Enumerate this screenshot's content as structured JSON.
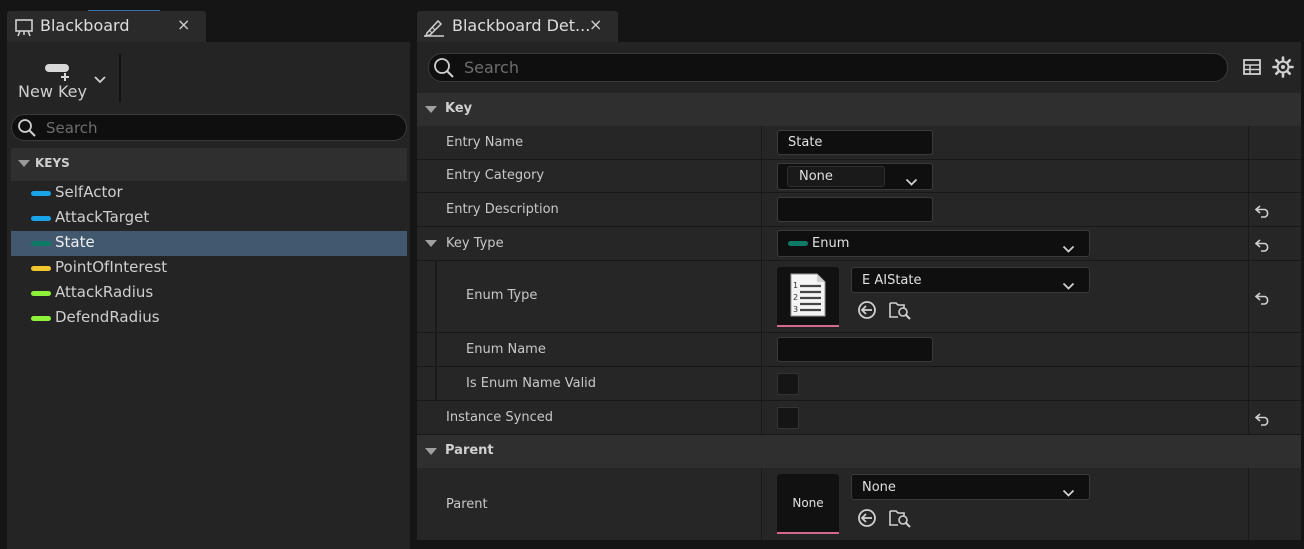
{
  "blackboard_panel": {
    "tab_title": "Blackboard",
    "close_glyph": "×",
    "new_key_label": "New Key",
    "search_placeholder": "Search",
    "keys_header": "KEYS",
    "keys": [
      {
        "name": "SelfActor",
        "color": "#1aa3e8"
      },
      {
        "name": "AttackTarget",
        "color": "#1aa3e8"
      },
      {
        "name": "State",
        "color": "#0d7a68",
        "selected": true
      },
      {
        "name": "PointOfInterest",
        "color": "#f2c72e"
      },
      {
        "name": "AttackRadius",
        "color": "#8ef23a"
      },
      {
        "name": "DefendRadius",
        "color": "#8ef23a"
      }
    ]
  },
  "details_panel": {
    "tab_title": "Blackboard Det...",
    "close_glyph": "×",
    "search_placeholder": "Search",
    "sections": {
      "key": "Key",
      "parent": "Parent"
    },
    "rows": {
      "entry_name": {
        "label": "Entry Name",
        "value": "State"
      },
      "entry_category": {
        "label": "Entry Category",
        "value": "None"
      },
      "entry_description": {
        "label": "Entry Description",
        "value": ""
      },
      "key_type": {
        "label": "Key Type",
        "value": "Enum",
        "color": "#0d7a68"
      },
      "enum_type": {
        "label": "Enum Type",
        "value": "E AIState"
      },
      "enum_name": {
        "label": "Enum Name",
        "value": ""
      },
      "is_enum_name_valid": {
        "label": "Is Enum Name Valid",
        "checked": false
      },
      "instance_synced": {
        "label": "Instance Synced",
        "checked": false
      },
      "parent": {
        "label": "Parent",
        "value": "None",
        "thumbnail_text": "None"
      }
    }
  },
  "icons": {
    "blackboard_tab": "blackboard-icon",
    "details_tab": "pencil-icon",
    "new_key": "add-key-icon",
    "search": "search-icon",
    "table": "table-view-icon",
    "settings": "gear-icon",
    "reset": "reset-to-default-icon",
    "browse": "use-selected-asset-icon",
    "find": "browse-to-asset-icon",
    "enum_thumbnail": "enum-list-icon"
  },
  "colors": {
    "selection": "#42586f",
    "asset_underline": "#d26b8a"
  }
}
